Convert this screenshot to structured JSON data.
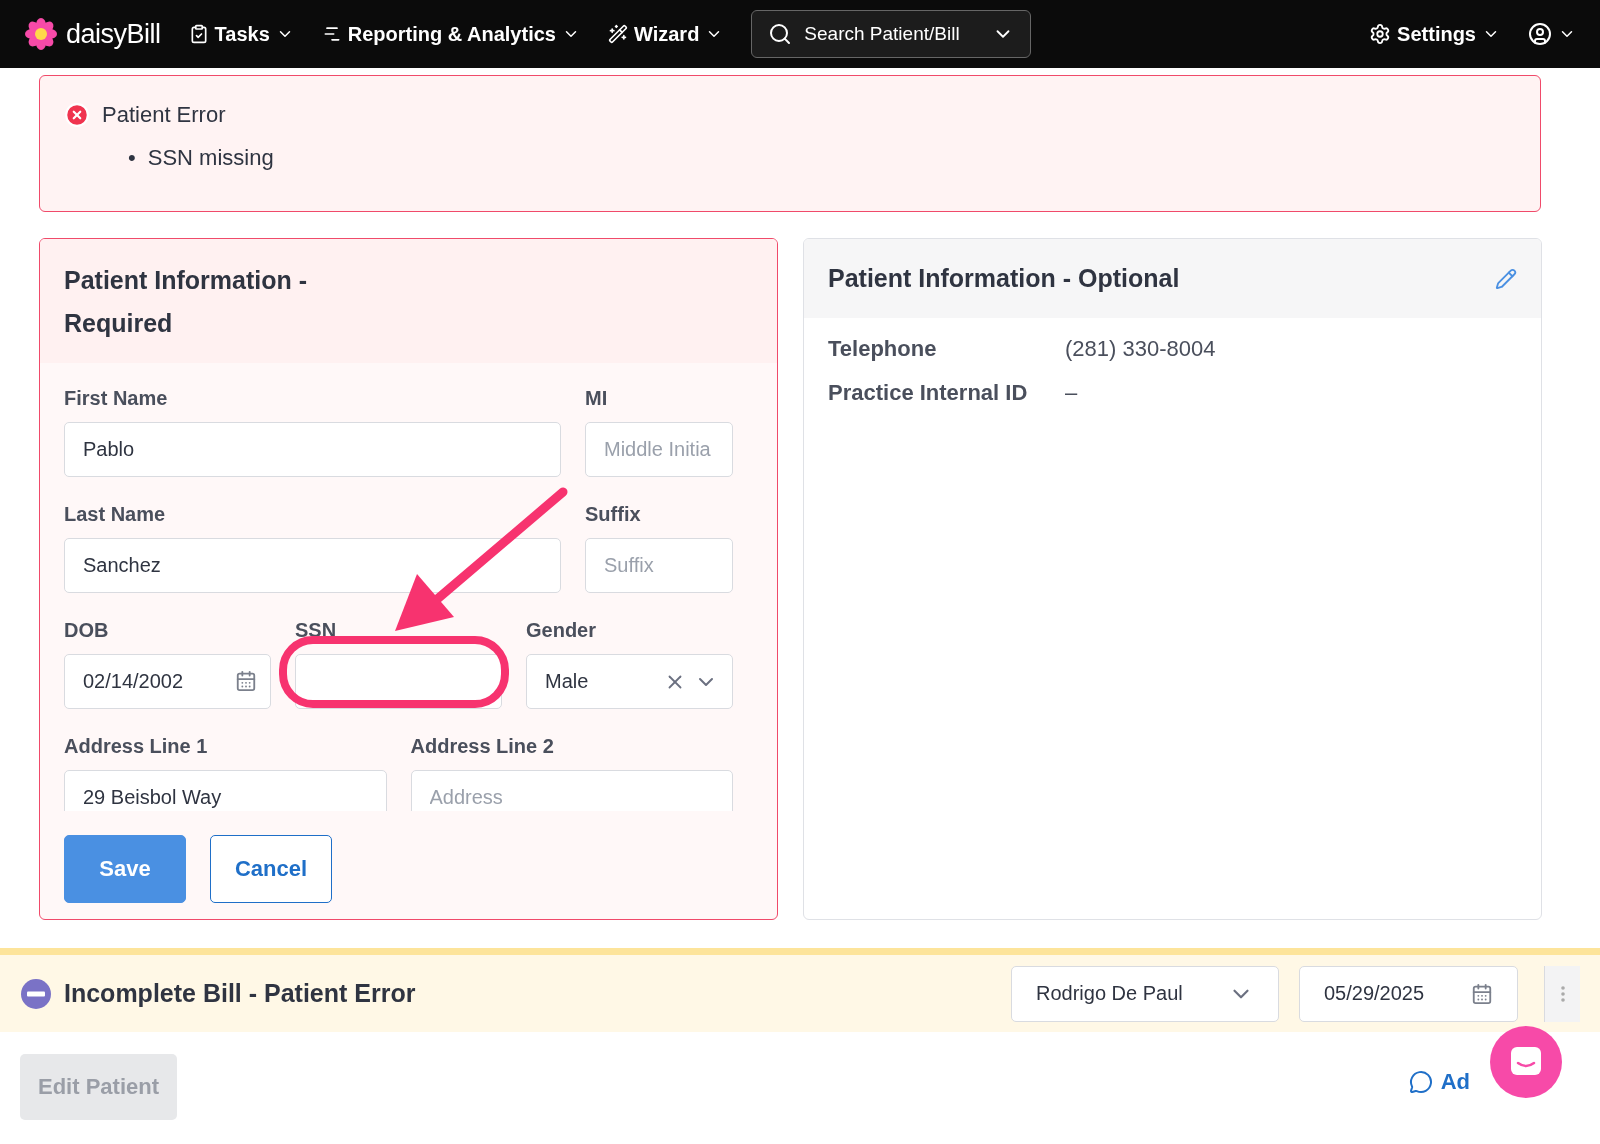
{
  "nav": {
    "logo": "daisyBill",
    "menus": [
      {
        "kind": "tasks",
        "label": "Tasks"
      },
      {
        "kind": "reports",
        "label": "Reporting & Analytics"
      },
      {
        "kind": "wizard",
        "label": "Wizard"
      }
    ],
    "search": {
      "placeholder": "Search Patient/Bill"
    },
    "settings": "Settings"
  },
  "error": {
    "title": "Patient Error",
    "marker": "•",
    "items": [
      "SSN missing"
    ]
  },
  "required": {
    "title": "Patient Information - Required",
    "rows": [
      {
        "kind": "wide_narrow",
        "fields": [
          {
            "kind": "text",
            "label": "First Name",
            "value": "Pablo"
          },
          {
            "kind": "text",
            "label": "MI",
            "placeholder": "Middle Initia"
          }
        ]
      },
      {
        "kind": "wide_narrow",
        "fields": [
          {
            "kind": "text",
            "label": "Last Name",
            "value": "Sanchez"
          },
          {
            "kind": "text",
            "label": "Suffix",
            "placeholder": "Suffix"
          }
        ]
      },
      {
        "kind": "thirds",
        "fields": [
          {
            "kind": "date",
            "label": "DOB",
            "value": "02/14/2002"
          },
          {
            "kind": "text",
            "label": "SSN",
            "highlighted": true
          },
          {
            "kind": "select",
            "label": "Gender",
            "value": "Male"
          }
        ]
      },
      {
        "kind": "halves",
        "fields": [
          {
            "kind": "text",
            "label": "Address Line 1",
            "value": "29 Beisbol Way"
          },
          {
            "kind": "text",
            "label": "Address Line 2",
            "placeholder": "Address"
          }
        ]
      }
    ],
    "buttons": [
      {
        "kind": "primary",
        "label": "Save"
      },
      {
        "kind": "secondary",
        "label": "Cancel"
      }
    ]
  },
  "optional": {
    "title": "Patient Information - Optional",
    "rows": [
      {
        "label": "Telephone",
        "value": "(281) 330-8004"
      },
      {
        "label": "Practice Internal ID",
        "value": "–"
      }
    ]
  },
  "bill": {
    "status": "Incomplete Bill - Patient Error",
    "doctor": "Rodrigo De Paul",
    "date": "05/29/2025"
  },
  "footer": {
    "edit": {
      "label": "Edit Patient",
      "disabled": true
    },
    "link": "Ad"
  }
}
